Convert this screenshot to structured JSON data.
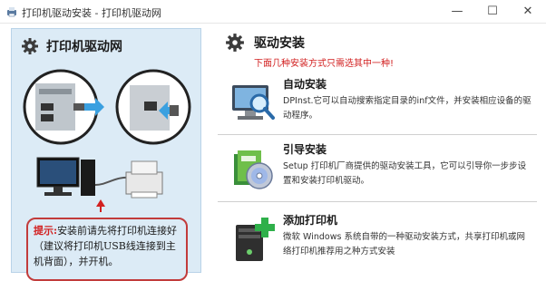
{
  "window": {
    "title": "打印机驱动安装 - 打印机驱动网",
    "minimize": "—",
    "maximize": "☐",
    "close": "✕"
  },
  "left_panel": {
    "title": "打印机驱动网",
    "tip_label": "提示:",
    "tip_text": "安装前请先将打印机连接好（建议将打印机USB线连接到主机背面），并开机。"
  },
  "main": {
    "title": "驱动安装",
    "subtitle": "下面几种安装方式只需选其中一种!",
    "options": [
      {
        "title": "自动安装",
        "description": "DPInst.它可以自动搜索指定目录的inf文件，并安装相应设备的驱动程序。",
        "icon": "monitor-magnifier-icon"
      },
      {
        "title": "引导安装",
        "description": "Setup 打印机厂商提供的驱动安装工具，它可以引导你一步步设置和安装打印机驱动。",
        "icon": "setup-disc-icon"
      },
      {
        "title": "添加打印机",
        "description": "微软 Windows 系统自带的一种驱动安装方式，共享打印机或网络打印机推荐用之种方式安装",
        "icon": "pc-add-icon"
      }
    ]
  },
  "colors": {
    "accent_red": "#d22020",
    "panel_bg": "#dcebf6",
    "tip_border": "#c23b3b"
  }
}
